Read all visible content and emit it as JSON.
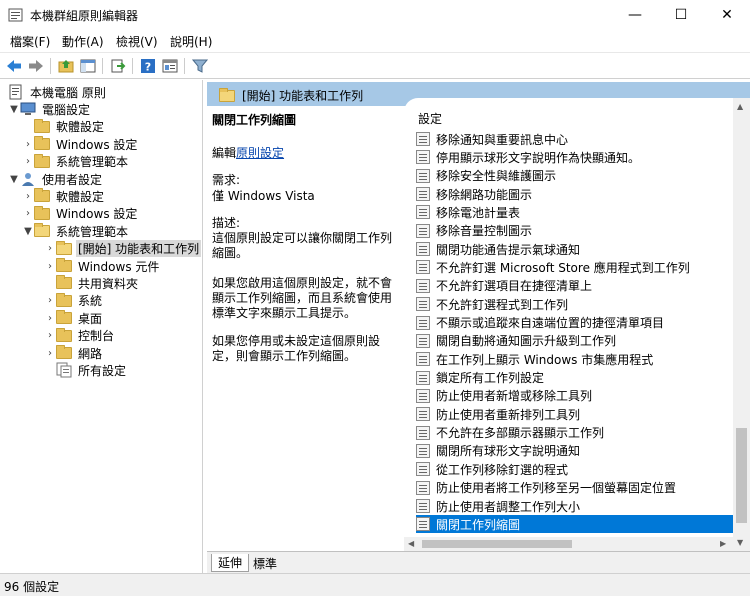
{
  "window": {
    "title": "本機群組原則編輯器",
    "minimize": "—",
    "maximize": "☐",
    "close": "✕"
  },
  "menu": [
    "檔案(F)",
    "動作(A)",
    "檢視(V)",
    "說明(H)"
  ],
  "toolbar": {
    "icons": [
      "back-icon",
      "forward-icon",
      "up-folder-icon",
      "show-tree-icon",
      "export-icon",
      "help-icon",
      "properties-icon",
      "filter-icon"
    ]
  },
  "tree": {
    "items": [
      {
        "label": "本機電腦 原則",
        "level": 0,
        "arrow": "",
        "icon": "policy-root"
      },
      {
        "label": "電腦設定",
        "level": 1,
        "arrow": "▼",
        "icon": "computer"
      },
      {
        "label": "軟體設定",
        "level": 2,
        "arrow": "",
        "icon": "folder"
      },
      {
        "label": "Windows 設定",
        "level": 2,
        "arrow": "›",
        "icon": "folder"
      },
      {
        "label": "系統管理範本",
        "level": 2,
        "arrow": "›",
        "icon": "folder"
      },
      {
        "label": "使用者設定",
        "level": 1,
        "arrow": "▼",
        "icon": "user"
      },
      {
        "label": "軟體設定",
        "level": 2,
        "arrow": "›",
        "icon": "folder"
      },
      {
        "label": "Windows 設定",
        "level": 2,
        "arrow": "›",
        "icon": "folder"
      },
      {
        "label": "系統管理範本",
        "level": 2,
        "arrow": "▼",
        "icon": "folder-open"
      },
      {
        "label": "[開始] 功能表和工作列",
        "level": 3,
        "arrow": "›",
        "icon": "folder-open",
        "selected": true
      },
      {
        "label": "Windows 元件",
        "level": 3,
        "arrow": "›",
        "icon": "folder"
      },
      {
        "label": "共用資料夾",
        "level": 3,
        "arrow": "",
        "icon": "folder"
      },
      {
        "label": "系統",
        "level": 3,
        "arrow": "›",
        "icon": "folder"
      },
      {
        "label": "桌面",
        "level": 3,
        "arrow": "›",
        "icon": "folder"
      },
      {
        "label": "控制台",
        "level": 3,
        "arrow": "›",
        "icon": "folder"
      },
      {
        "label": "網路",
        "level": 3,
        "arrow": "›",
        "icon": "folder"
      },
      {
        "label": "所有設定",
        "level": 3,
        "arrow": "",
        "icon": "settings"
      }
    ]
  },
  "header": {
    "title": "[開始] 功能表和工作列"
  },
  "description": {
    "title": "關閉工作列縮圖",
    "edit_prefix": "編輯",
    "edit_link": "原則設定",
    "requirement_label": "需求:",
    "requirement_value": "僅 Windows Vista",
    "desc_label": "描述:",
    "desc_text": "這個原則設定可以讓你關閉工作列縮圖。",
    "enabled_text": "如果您啟用這個原則設定，就不會顯示工作列縮圖，而且系統會使用標準文字來顯示工具提示。",
    "disabled_text": "如果您停用或未設定這個原則設定，則會顯示工作列縮圖。"
  },
  "list": {
    "column_header": "設定",
    "items": [
      "移除通知與重要訊息中心",
      "停用顯示球形文字說明作為快顯通知。",
      "移除安全性與維護圖示",
      "移除網路功能圖示",
      "移除電池計量表",
      "移除音量控制圖示",
      "關閉功能通告提示氣球通知",
      "不允許釘選 Microsoft Store 應用程式到工作列",
      "不允許釘選項目在捷徑清單上",
      "不允許釘選程式到工作列",
      "不顯示或追蹤來自遠端位置的捷徑清單項目",
      "關閉自動將通知圖示升級到工作列",
      "在工作列上顯示 Windows 市集應用程式",
      "鎖定所有工作列設定",
      "防止使用者新增或移除工具列",
      "防止使用者重新排列工具列",
      "不允許在多部顯示器顯示工作列",
      "關閉所有球形文字說明通知",
      "從工作列移除釘選的程式",
      "防止使用者將工作列移至另一個螢幕固定位置",
      "防止使用者調整工作列大小",
      "關閉工作列縮圖"
    ],
    "selected_index": 21
  },
  "tabs": [
    "延伸",
    "標準"
  ],
  "status": {
    "text": "96 個設定"
  },
  "colors": {
    "header_bg": "#a6c8e6",
    "selection": "#0078d7",
    "link": "#0645ad"
  }
}
